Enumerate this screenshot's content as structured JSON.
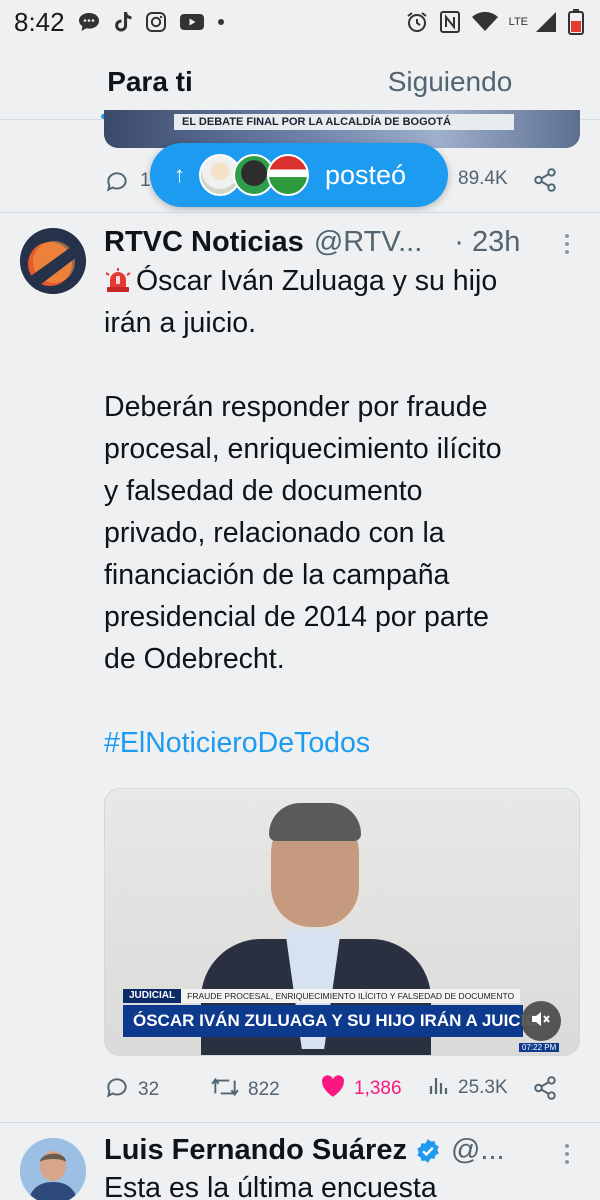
{
  "status_bar": {
    "time": "8:42",
    "network": "LTE",
    "icons": [
      "chat-bubble-icon",
      "tiktok-icon",
      "instagram-icon",
      "youtube-icon",
      "dot-icon",
      "alarm-icon",
      "nfc-icon",
      "wifi-icon",
      "signal-icon",
      "battery-icon"
    ]
  },
  "tabs": [
    {
      "label": "Para ti",
      "active": true
    },
    {
      "label": "Siguiendo",
      "active": false
    }
  ],
  "previous_tweet": {
    "media_banner": "EL DEBATE FINAL POR LA ALCALDÍA DE BOGOTÁ",
    "reply_count": "1",
    "views": "89.4K"
  },
  "new_posts_pill": {
    "label": "posteó"
  },
  "tweet": {
    "name": "RTVC Noticias",
    "handle": "@RTV...",
    "time": "· 23h",
    "line1": "Óscar Iván Zuluaga y su hijo",
    "line2": "irán a juicio.",
    "para2": [
      "Deberán responder por fraude",
      "procesal, enriquecimiento ilícito",
      "y falsedad de documento",
      "privado, relacionado con la",
      "financiación de la campaña",
      "presidencial de 2014 por parte",
      "de Odebrecht."
    ],
    "hashtag": "#ElNoticieroDeTodos",
    "media": {
      "tag": "JUDICIAL",
      "subtitle": "FRAUDE PROCESAL, ENRIQUECIMIENTO ILÍCITO Y FALSEDAD DE DOCUMENTO",
      "headline": "ÓSCAR IVÁN ZULUAGA Y SU HIJO IRÁN A JUICIO",
      "clock": "07:22 PM"
    },
    "replies": "32",
    "retweets": "822",
    "likes": "1,386",
    "views": "25.3K",
    "liked": true
  },
  "next_tweet": {
    "name": "Luis Fernando Suárez",
    "handle": "@...",
    "text": "Esta es la última encuesta"
  },
  "colors": {
    "accent": "#1d9bf0",
    "like": "#f91880",
    "muted": "#536471",
    "background": "#eef0f2"
  }
}
